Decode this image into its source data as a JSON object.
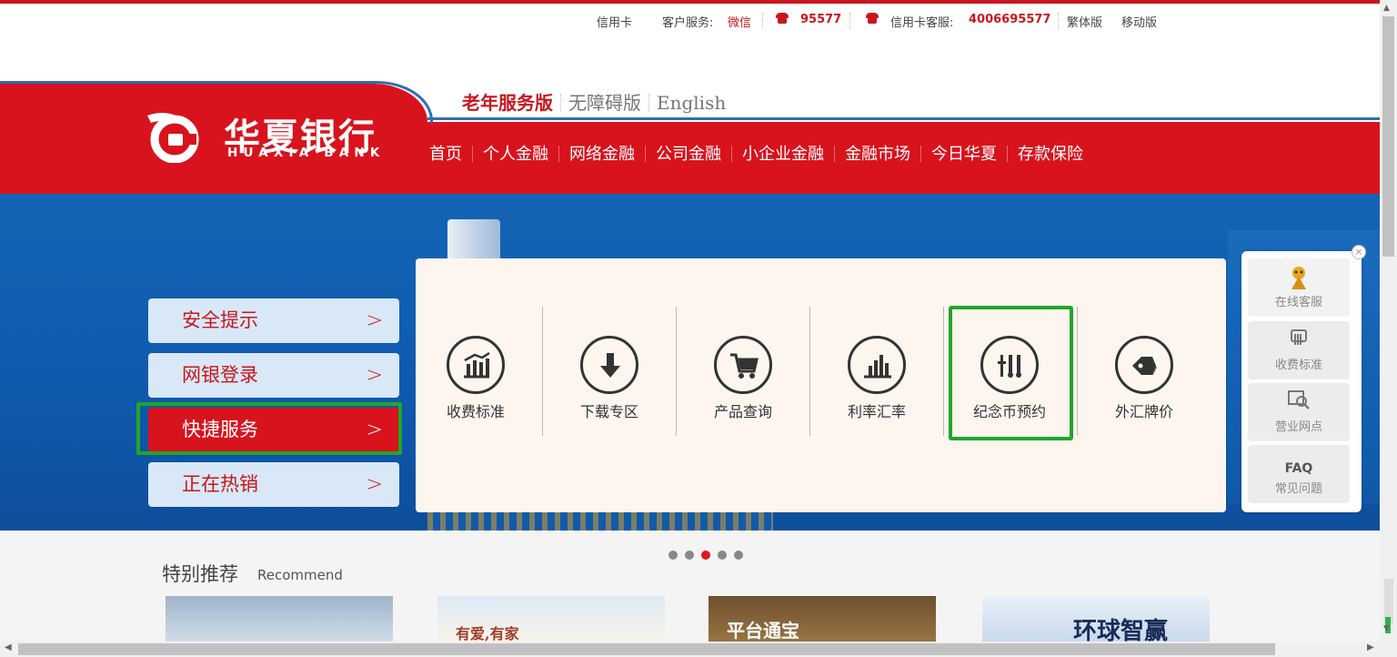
{
  "topbar": {
    "credit_card": "信用卡",
    "customer_service_label": "客户服务:",
    "wechat": "微信",
    "hotline": "95577",
    "card_service_label": "信用卡客服:",
    "card_hotline": "4006695577",
    "traditional": "繁体版",
    "mobile": "移动版"
  },
  "logo": {
    "cn": "华夏银行",
    "en": "HUAXIA BANK"
  },
  "versions": {
    "elder": "老年服务版",
    "accessible": "无障碍版",
    "english": "English"
  },
  "nav": [
    "首页",
    "个人金融",
    "网络金融",
    "公司金融",
    "小企业金融",
    "金融市场",
    "今日华夏",
    "存款保险"
  ],
  "left_menu": [
    {
      "label": "安全提示",
      "active": false
    },
    {
      "label": "网银登录",
      "active": false
    },
    {
      "label": "快捷服务",
      "active": true
    },
    {
      "label": "正在热销",
      "active": false
    }
  ],
  "services": [
    {
      "label": "收费标准",
      "icon": "bar-chart-icon"
    },
    {
      "label": "下载专区",
      "icon": "download-arrow-icon"
    },
    {
      "label": "产品查询",
      "icon": "cart-icon"
    },
    {
      "label": "利率汇率",
      "icon": "bar-graph-icon"
    },
    {
      "label": "纪念币预约",
      "icon": "tools-icon"
    },
    {
      "label": "外汇牌价",
      "icon": "tag-icon"
    }
  ],
  "right_float": {
    "online": "在线客服",
    "fees": "收费标准",
    "outlets": "营业网点",
    "faq_tag": "FAQ",
    "faq": "常见问题"
  },
  "recommend": {
    "title": "特别推荐",
    "subtitle": "Recommend",
    "thumb2_caption": "有爱,有家",
    "thumb3_caption": "平台通宝",
    "thumb4_caption": "环球智赢"
  },
  "carousel": {
    "count": 5,
    "active_index": 2
  },
  "colors": {
    "brand_red": "#d8131d",
    "nav_blue": "#2f6fb4",
    "highlight_green": "#22a52a",
    "banner_blue": "#1464b6"
  }
}
